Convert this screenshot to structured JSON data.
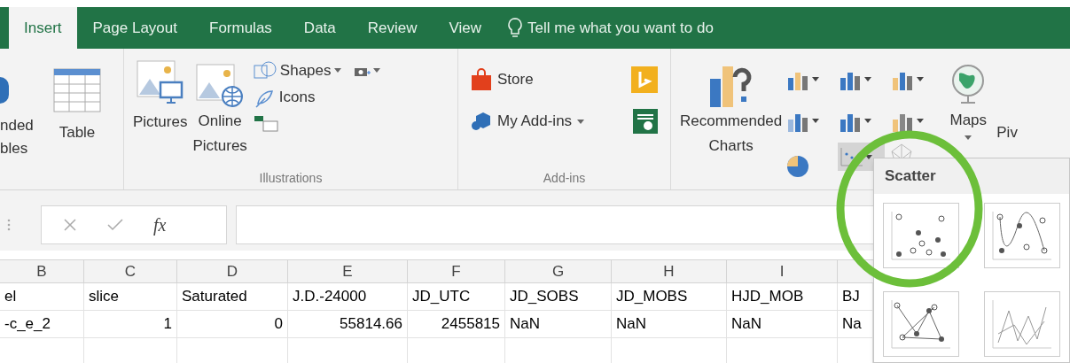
{
  "tabs": [
    {
      "label": "Insert",
      "selected": true
    },
    {
      "label": "Page Layout",
      "selected": false
    },
    {
      "label": "Formulas",
      "selected": false
    },
    {
      "label": "Data",
      "selected": false
    },
    {
      "label": "Review",
      "selected": false
    },
    {
      "label": "View",
      "selected": false
    }
  ],
  "tell_me": {
    "placeholder": "Tell me what you want to do"
  },
  "tables_group": {
    "cut_button": [
      "nded",
      "bles"
    ],
    "table": "Table"
  },
  "illustrations": {
    "label": "Illustrations",
    "pictures": "Pictures",
    "online_pictures": [
      "Online",
      "Pictures"
    ],
    "shapes": "Shapes",
    "icons": "Icons"
  },
  "addins": {
    "label": "Add-ins",
    "store": "Store",
    "my_addins": "My Add-ins"
  },
  "charts": {
    "recommended": [
      "Recommended",
      "Charts"
    ],
    "scatter_open": true,
    "maps": "Maps",
    "cut_button": "Piv"
  },
  "scatter_menu": {
    "title": "Scatter"
  },
  "formula_bar": {
    "fx": "fx"
  },
  "sheet": {
    "columns": [
      "B",
      "C",
      "D",
      "E",
      "F",
      "G",
      "H",
      "I"
    ],
    "rows": [
      [
        {
          "text": "el",
          "kind": "text"
        },
        {
          "text": "slice",
          "kind": "text"
        },
        {
          "text": "Saturated",
          "kind": "text"
        },
        {
          "text": "J.D.-24000",
          "kind": "text"
        },
        {
          "text": "JD_UTC",
          "kind": "text"
        },
        {
          "text": "JD_SOBS",
          "kind": "text"
        },
        {
          "text": "JD_MOBS",
          "kind": "text"
        },
        {
          "text": "HJD_MOB",
          "kind": "text"
        },
        {
          "text": "BJ",
          "kind": "text"
        }
      ],
      [
        {
          "text": "-c_e_2",
          "kind": "text"
        },
        {
          "text": "1",
          "kind": "number"
        },
        {
          "text": "0",
          "kind": "number"
        },
        {
          "text": "55814.66",
          "kind": "number"
        },
        {
          "text": "2455815",
          "kind": "number"
        },
        {
          "text": "NaN",
          "kind": "text"
        },
        {
          "text": "NaN",
          "kind": "text"
        },
        {
          "text": "NaN",
          "kind": "text"
        },
        {
          "text": "Na",
          "kind": "text"
        }
      ]
    ]
  }
}
